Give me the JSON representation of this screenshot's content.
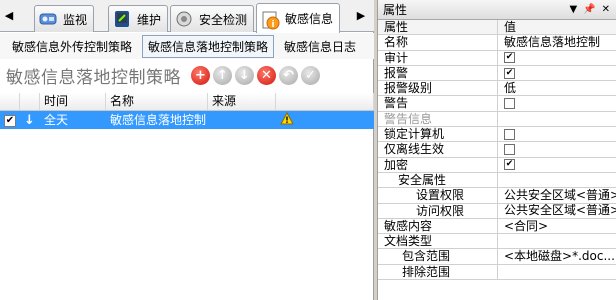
{
  "tabs": [
    {
      "label": "监视",
      "icon": "monitor-icon"
    },
    {
      "label": "维护",
      "icon": "maintenance-icon"
    },
    {
      "label": "安全检测",
      "icon": "security-check-icon"
    },
    {
      "label": "敏感信息",
      "icon": "sensitive-info-icon"
    }
  ],
  "subtabs": [
    {
      "label": "敏感信息外传控制策略"
    },
    {
      "label": "敏感信息落地控制策略"
    },
    {
      "label": "敏感信息日志"
    }
  ],
  "page_title": "敏感信息落地控制策略",
  "toolbar": {
    "add": "+",
    "up": "↑",
    "down": "↓",
    "delete": "✕",
    "undo": "↶",
    "apply": "✓"
  },
  "grid": {
    "headers": [
      "时间",
      "名称",
      "来源"
    ],
    "rows": [
      {
        "checked": true,
        "time": "全天",
        "name": "敏感信息落地控制",
        "source": ""
      }
    ]
  },
  "properties_panel": {
    "title": "属性",
    "col_name": "属性",
    "col_value": "值",
    "rows": [
      {
        "name": "名称",
        "value": "敏感信息落地控制",
        "type": "text"
      },
      {
        "name": "审计",
        "value": "checked",
        "type": "check"
      },
      {
        "name": "报警",
        "value": "checked",
        "type": "check"
      },
      {
        "name": "报警级别",
        "value": "低",
        "type": "text"
      },
      {
        "name": "警告",
        "value": "unchecked",
        "type": "check"
      },
      {
        "name": "警告信息",
        "value": "",
        "type": "disabled"
      },
      {
        "name": "锁定计算机",
        "value": "unchecked",
        "type": "check"
      },
      {
        "name": "仅离线生效",
        "value": "unchecked",
        "type": "check"
      },
      {
        "name": "加密",
        "value": "checked",
        "type": "check"
      },
      {
        "name": "安全属性",
        "value": "",
        "type": "group"
      },
      {
        "name": "设置权限",
        "value": "公共安全区域<普通>",
        "type": "sub"
      },
      {
        "name": "访问权限",
        "value": "公共安全区域<普通>",
        "type": "sub"
      },
      {
        "name": "敏感内容",
        "value": "<合同>",
        "type": "text"
      },
      {
        "name": "文档类型",
        "value": "",
        "type": "text"
      },
      {
        "name": "包含范围",
        "value": "<本地磁盘>*.doc...",
        "type": "sub2"
      },
      {
        "name": "排除范围",
        "value": "",
        "type": "sub2"
      }
    ]
  },
  "colors": {
    "selection": "#3399ff",
    "accent_red": "#d1140b"
  }
}
